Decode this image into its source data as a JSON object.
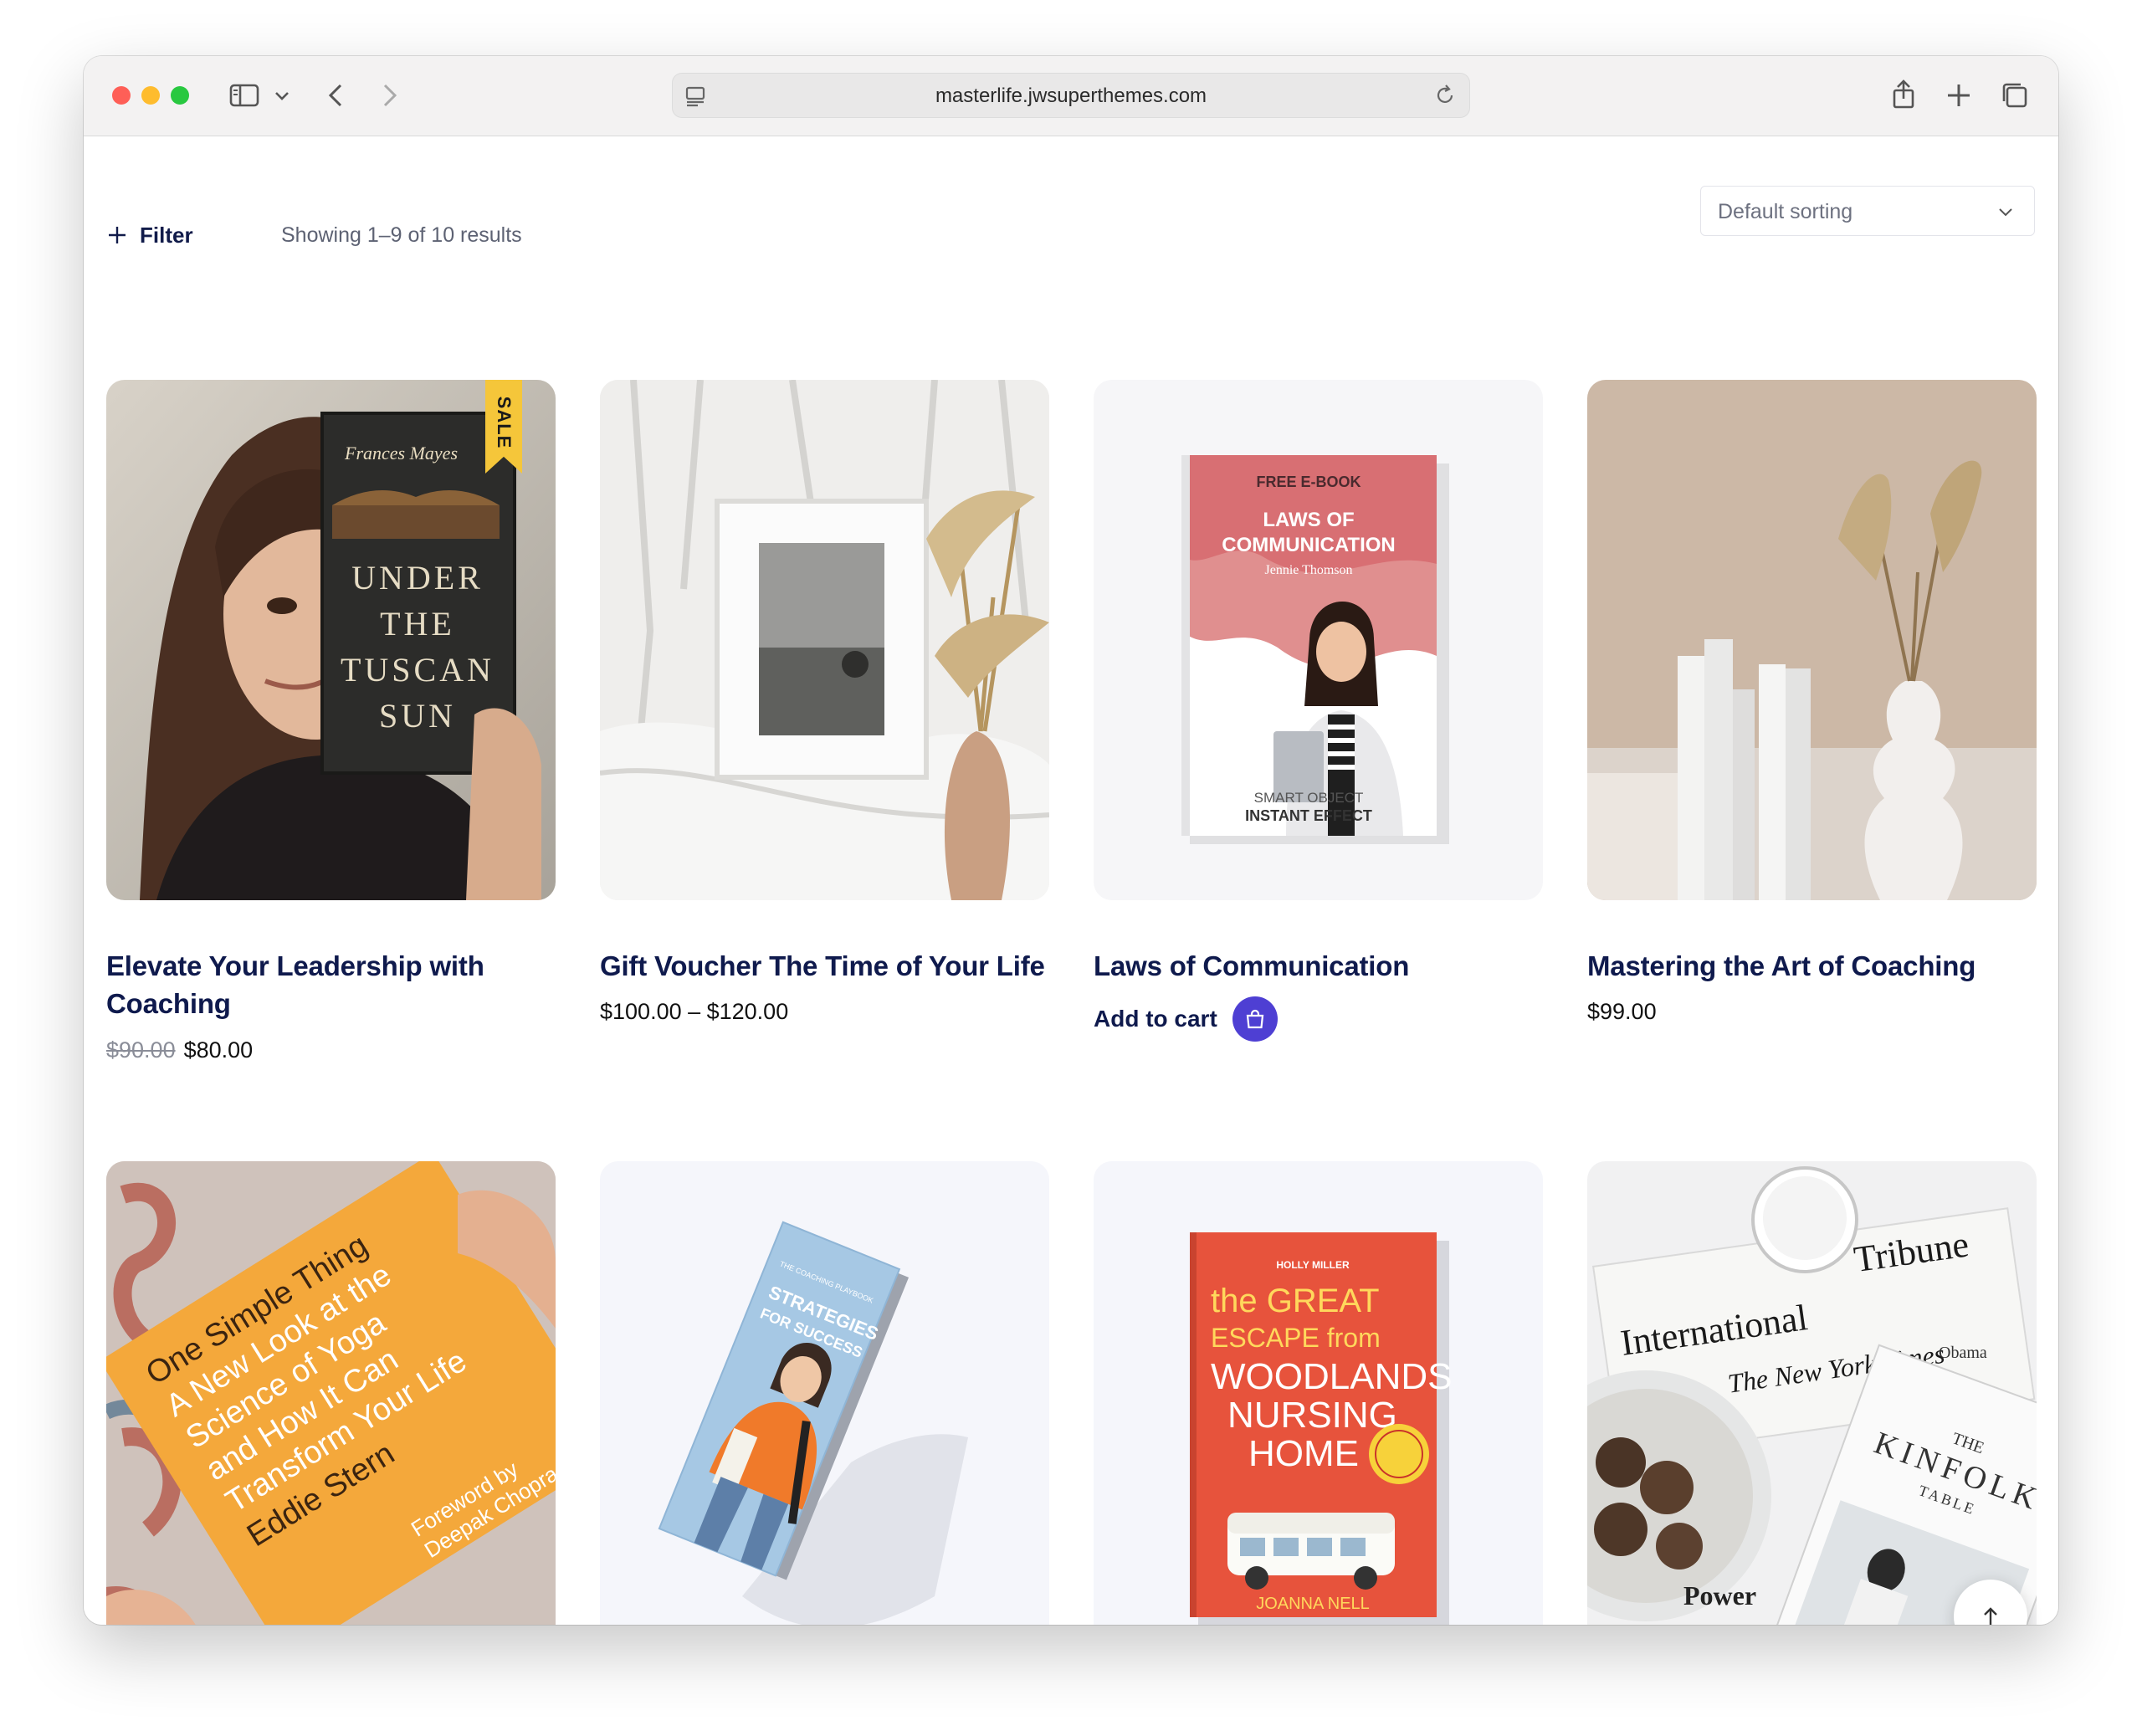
{
  "browser": {
    "url": "masterlife.jwsuperthemes.com"
  },
  "shop": {
    "filter_label": "Filter",
    "results_text": "Showing 1–9 of 10 results",
    "sorting_value": "Default sorting"
  },
  "products": [
    {
      "title": "Elevate Your Leadership with Coaching",
      "old_price": "$90.00",
      "price": "$80.00",
      "badge": "SALE",
      "cover": {
        "author": "Frances Mayes",
        "words": [
          "UNDER",
          "THE",
          "TUSCAN",
          "SUN"
        ]
      }
    },
    {
      "title": "Gift Voucher The Time of Your Life",
      "price": "$100.00 – $120.00"
    },
    {
      "title": "Laws of Communication",
      "action_label": "Add to cart",
      "cover": {
        "kicker": "FREE E-BOOK",
        "line1": "LAWS OF",
        "line2": "COMMUNICATION",
        "author": "Jennie Thomson",
        "footer1": "SMART OBJECT",
        "footer2": "INSTANT EFFECT"
      }
    },
    {
      "title": "Mastering the Art of Coaching",
      "price": "$99.00"
    },
    {
      "cover": {
        "line1": "One Simple Thing",
        "line2": "A New Look at the",
        "line3": "Science of Yoga",
        "line4": "and How It Can",
        "line5": "Transform Your Life",
        "author": "Eddie Stern",
        "foreword1": "Foreword by",
        "foreword2": "Deepak Chopra"
      }
    },
    {
      "cover": {
        "kicker": "THE COACHING PLAYBOOK",
        "line1": "STRATEGIES",
        "line2": "FOR SUCCESS"
      }
    },
    {
      "cover": {
        "author_top": "HOLLY MILLER",
        "line1": "the GREAT",
        "line2": "ESCAPE from",
        "line3": "WOODLANDS",
        "line4": "NURSING",
        "line5": "HOME",
        "author": "JOANNA NELL"
      }
    },
    {
      "cover": {
        "paper1": "International",
        "paper2": "Tribune",
        "paper3": "The New York Times",
        "mag1": "THE",
        "mag2": "KINFOLK",
        "mag3": "TABLE",
        "snip1": "Obama",
        "snip2": "Power"
      }
    }
  ],
  "colors": {
    "accent": "#4e3fd3",
    "sale_badge": "#f5c63a",
    "heading": "#0f1a4d"
  }
}
